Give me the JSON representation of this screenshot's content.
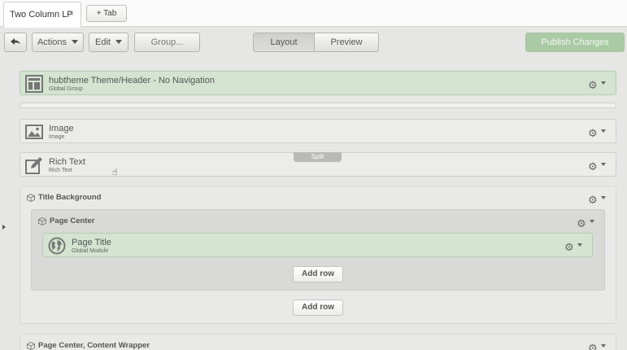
{
  "tabs": {
    "active_label": "Two Column LP",
    "close_glyph": "×",
    "add_tab_label": "+ Tab"
  },
  "toolbar": {
    "actions_label": "Actions",
    "edit_label": "Edit",
    "group_label": "Group...",
    "layout_label": "Layout",
    "preview_label": "Preview",
    "publish_label": "Publish Changes"
  },
  "modules": {
    "header": {
      "title": "hubtheme Theme/Header - No Navigation",
      "subtitle": "Global Group"
    },
    "image": {
      "title": "Image",
      "subtitle": "Image"
    },
    "rich_text": {
      "title": "Rich Text",
      "subtitle": "Rich Text"
    },
    "page_title": {
      "title": "Page Title",
      "subtitle": "Global Module"
    }
  },
  "split_label": "Split",
  "groups": {
    "title_background": "Title Background",
    "page_center": "Page Center",
    "page_center_wrapper": "Page Center, Content Wrapper"
  },
  "add_row_label": "Add row",
  "colors": {
    "green_module": "#d4e4d1",
    "publish": "#a9caa4",
    "background": "#e6e6e4"
  }
}
